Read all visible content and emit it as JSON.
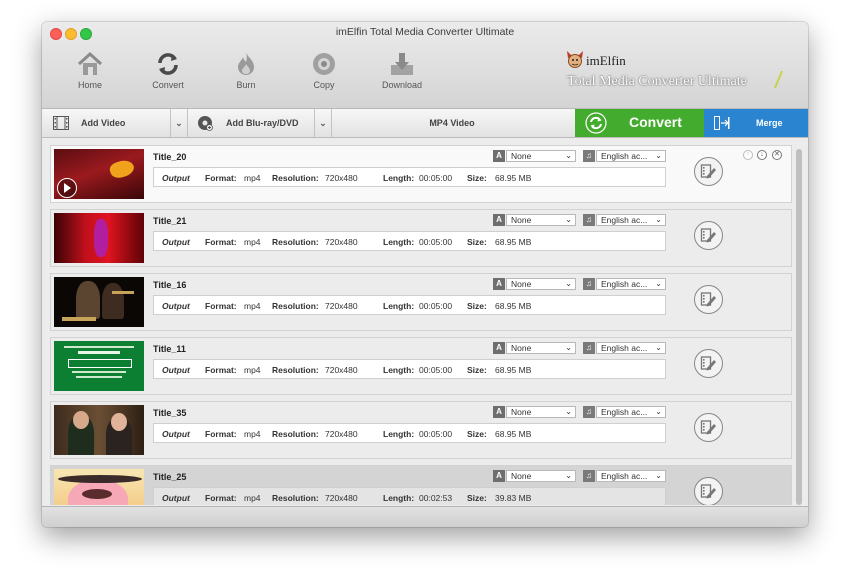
{
  "window": {
    "title": "imElfin Total Media Converter Ultimate"
  },
  "toolbar": {
    "items": [
      {
        "label": "Home",
        "icon": "home-icon"
      },
      {
        "label": "Convert",
        "icon": "refresh-icon"
      },
      {
        "label": "Burn",
        "icon": "fire-icon"
      },
      {
        "label": "Copy",
        "icon": "disc-icon"
      },
      {
        "label": "Download",
        "icon": "download-icon"
      }
    ]
  },
  "logo": {
    "brand": "imElfin",
    "product": "Total Media Converter Ultimate"
  },
  "actionbar": {
    "add_video": "Add Video",
    "add_bluray": "Add Blu-ray/DVD",
    "output_format": "MP4 Video",
    "convert": "Convert",
    "merge": "Merge"
  },
  "labels": {
    "output": "Output",
    "format": "Format:",
    "resolution": "Resolution:",
    "length": "Length:",
    "size": "Size:"
  },
  "titles": [
    {
      "name": "Title_20",
      "format": "mp4",
      "resolution": "720x480",
      "length": "00:05:00",
      "size": "68.95 MB",
      "subtitle": "None",
      "audio": "English ac..."
    },
    {
      "name": "Title_21",
      "format": "mp4",
      "resolution": "720x480",
      "length": "00:05:00",
      "size": "68.95 MB",
      "subtitle": "None",
      "audio": "English ac..."
    },
    {
      "name": "Title_16",
      "format": "mp4",
      "resolution": "720x480",
      "length": "00:05:00",
      "size": "68.95 MB",
      "subtitle": "None",
      "audio": "English ac..."
    },
    {
      "name": "Title_11",
      "format": "mp4",
      "resolution": "720x480",
      "length": "00:05:00",
      "size": "68.95 MB",
      "subtitle": "None",
      "audio": "English ac..."
    },
    {
      "name": "Title_35",
      "format": "mp4",
      "resolution": "720x480",
      "length": "00:05:00",
      "size": "68.95 MB",
      "subtitle": "None",
      "audio": "English ac..."
    },
    {
      "name": "Title_25",
      "format": "mp4",
      "resolution": "720x480",
      "length": "00:02:53",
      "size": "39.83 MB",
      "subtitle": "None",
      "audio": "English ac..."
    }
  ],
  "colors": {
    "convert": "#43ab2e",
    "merge": "#2a84cf"
  }
}
